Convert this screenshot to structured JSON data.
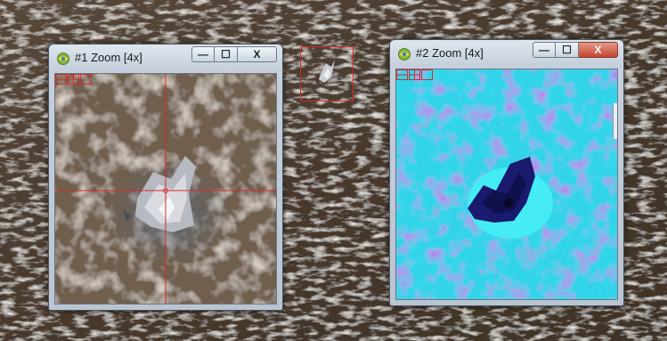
{
  "windows": [
    {
      "title": "#1 Zoom [4x]",
      "controls": {
        "minimize": "—",
        "maximize": "☐",
        "close": "X"
      }
    },
    {
      "title": "#2 Zoom [4x]",
      "controls": {
        "minimize": "—",
        "maximize": "☐",
        "close": "X"
      }
    }
  ],
  "colors": {
    "crosshair": "#d42a2a",
    "false_color_base": "#3bdcee",
    "false_color_dark": "#1a1a6e",
    "terrain": "#4a3d31"
  },
  "icons": [
    "app-globe-icon",
    "zoom-box-icon",
    "crosshair-icon",
    "window-minimize-icon",
    "window-maximize-icon",
    "window-close-icon"
  ]
}
